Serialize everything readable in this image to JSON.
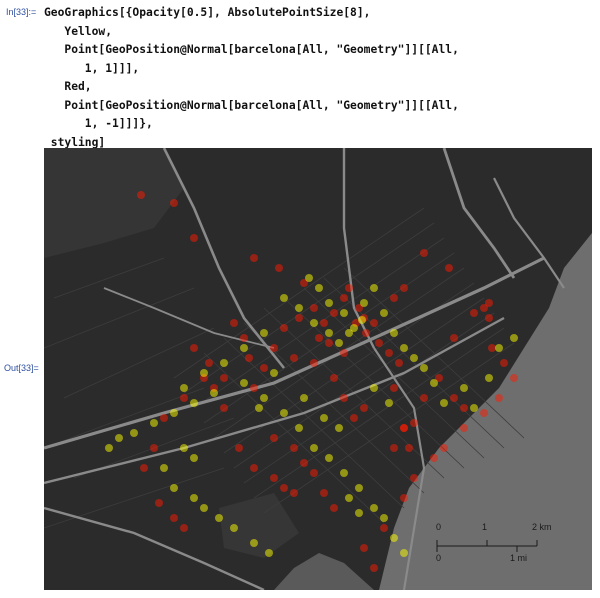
{
  "cell": {
    "in_label": "In[33]:=",
    "out_label": "Out[33]=",
    "code_lines": [
      "GeoGraphics[{Opacity[0.5], AbsolutePointSize[8],",
      "   Yellow,",
      "   Point[GeoPosition@Normal[barcelona[All, \"Geometry\"]][[All,",
      "      1, 1]]],",
      "   Red,",
      "   Point[GeoPosition@Normal[barcelona[All, \"Geometry\"]][[All,",
      "      1, -1]]]},",
      " styling]"
    ]
  },
  "map": {
    "colors": {
      "land": "#2b2b2b",
      "sea": "#6e6e6e",
      "road": "#8a8a8a",
      "yellow_point": "#ffff00",
      "red_point": "#ff1a00"
    },
    "scale_bar": {
      "km_ticks": [
        "0",
        "1",
        "2 km"
      ],
      "mi_ticks": [
        "0",
        "1 mi"
      ]
    }
  }
}
